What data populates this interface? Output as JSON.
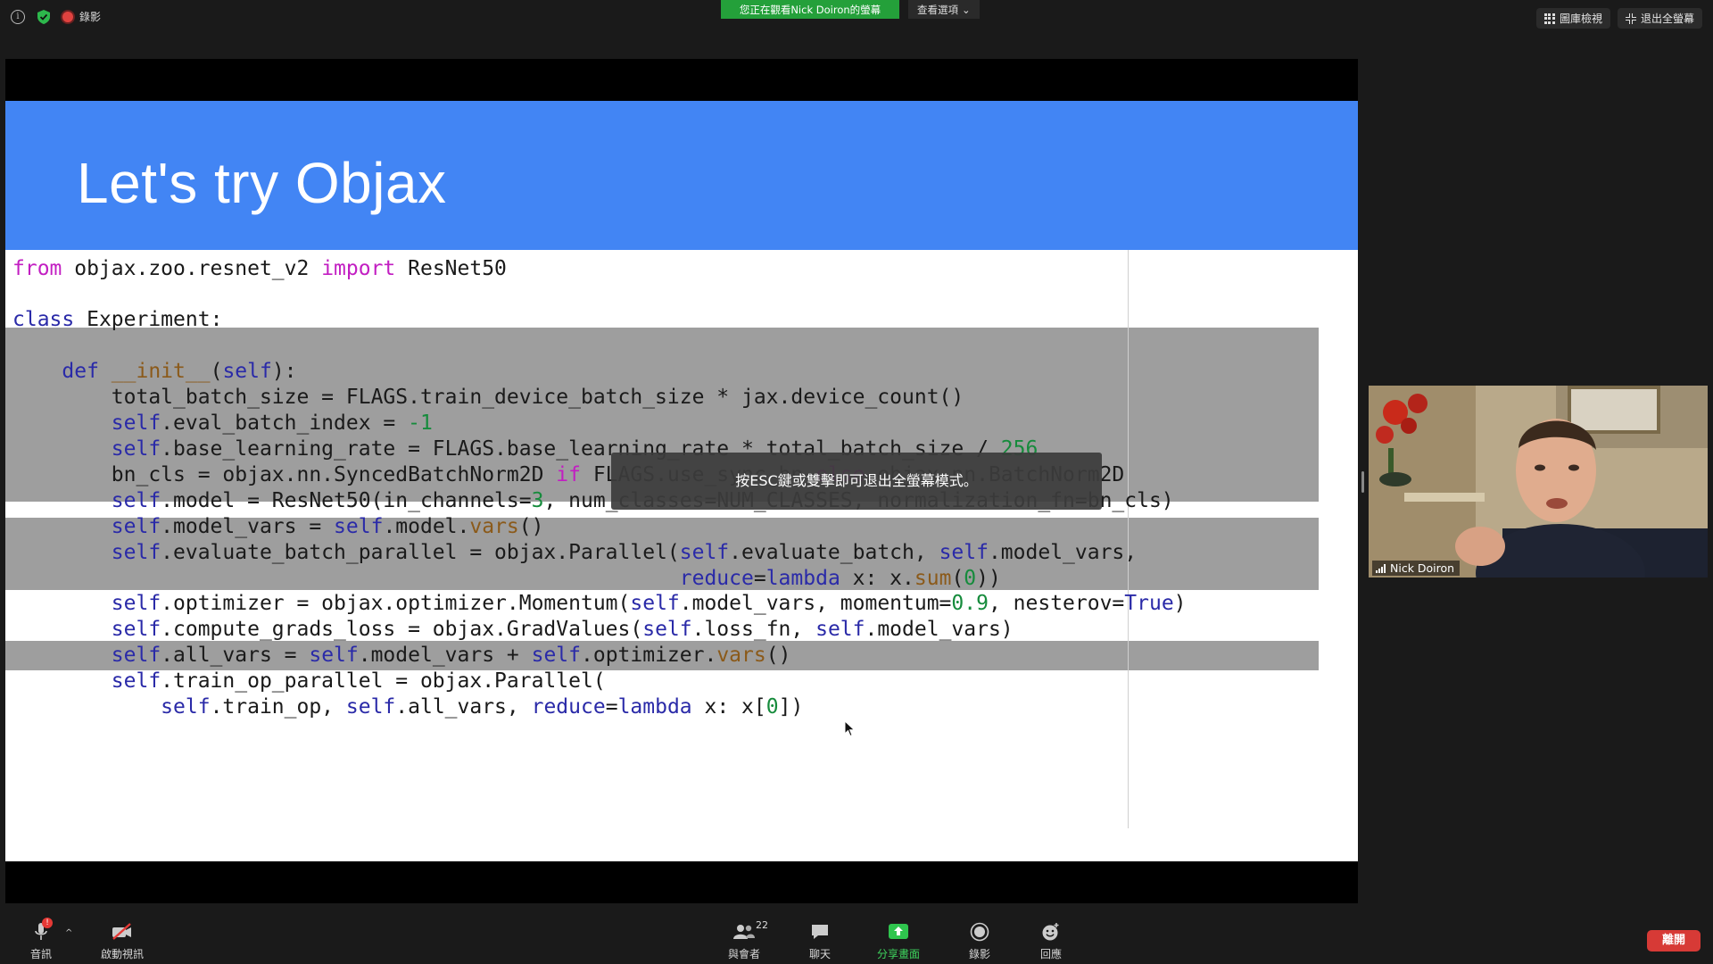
{
  "topbar": {
    "info_icon": "info-icon",
    "shield_icon": "shield-check-icon",
    "recording_label": "錄影",
    "viewing_label": "您正在觀看Nick Doiron的螢幕",
    "view_options_label": "查看選項",
    "gallery_label": "圖庫檢視",
    "exit_fullscreen_label": "退出全螢幕"
  },
  "slide": {
    "title": "Let's try Objax",
    "header_color": "#4285f4"
  },
  "code": {
    "lines": [
      "from objax.zoo.resnet_v2 import ResNet50",
      "class Experiment:",
      "    def __init__(self):",
      "        total_batch_size = FLAGS.train_device_batch_size * jax.device_count()",
      "        self.eval_batch_index = -1",
      "        self.base_learning_rate = FLAGS.base_learning_rate * total_batch_size / 256",
      "        bn_cls = objax.nn.SyncedBatchNorm2D if FLAGS.use_sync_bn else objax.nn.BatchNorm2D",
      "        self.model = ResNet50(in_channels=3, num_classes=NUM_CLASSES, normalization_fn=bn_cls)",
      "        self.model_vars = self.model.vars()",
      "        self.evaluate_batch_parallel = objax.Parallel(self.evaluate_batch, self.model_vars,",
      "                                                      reduce=lambda x: x.sum(0))",
      "        self.optimizer = objax.optimizer.Momentum(self.model_vars, momentum=0.9, nesterov=True)",
      "        self.compute_grads_loss = objax.GradValues(self.loss_fn, self.model_vars)",
      "        self.all_vars = self.model_vars + self.optimizer.vars()",
      "        self.train_op_parallel = objax.Parallel(",
      "            self.train_op, self.all_vars, reduce=lambda x: x[0])"
    ]
  },
  "esc_toast": "按ESC鍵或雙擊即可退出全螢幕模式。",
  "video": {
    "participant_name": "Nick Doiron"
  },
  "toolbar": {
    "audio_label": "音訊",
    "audio_badge": "!",
    "video_label": "啟動視訊",
    "participants_label": "與會者",
    "participants_count": "22",
    "chat_label": "聊天",
    "share_label": "分享畫面",
    "record_label": "錄影",
    "reactions_label": "回應",
    "leave_label": "離開"
  }
}
